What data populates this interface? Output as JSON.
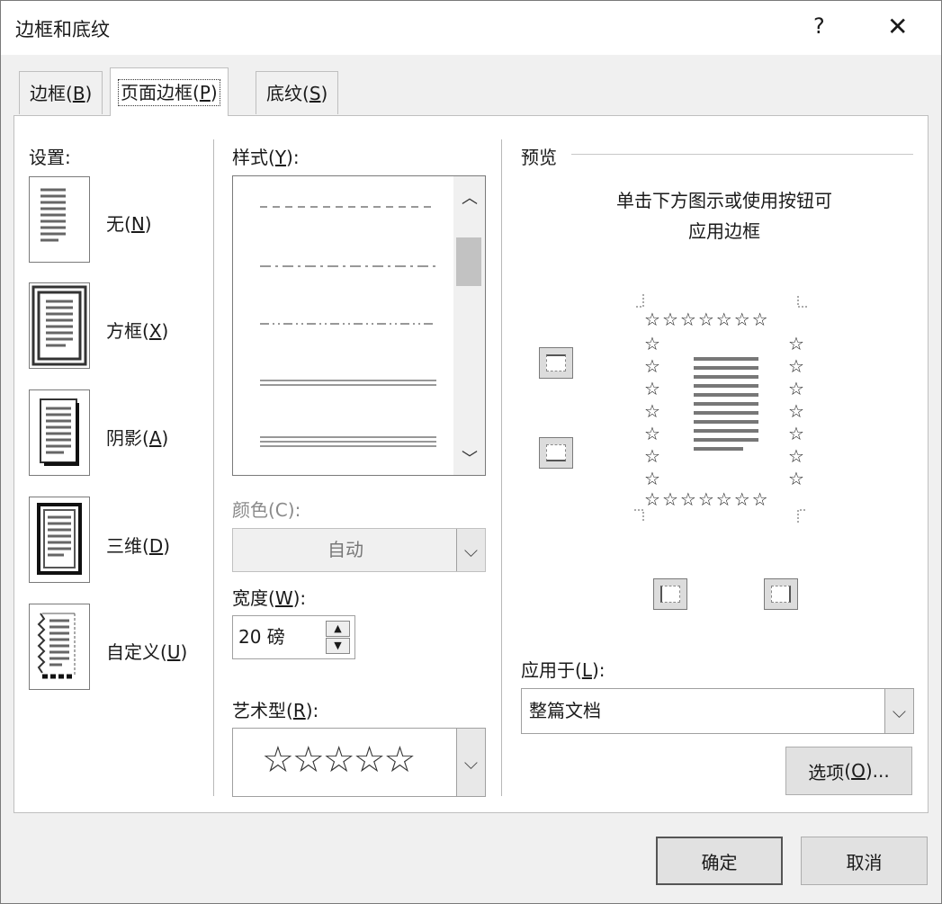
{
  "window": {
    "title": "边框和底纹",
    "help": "?",
    "close": "✕"
  },
  "tabs": [
    {
      "label": "边框",
      "key": "B"
    },
    {
      "label": "页面边框",
      "key": "P"
    },
    {
      "label": "底纹",
      "key": "S"
    }
  ],
  "settings": {
    "heading": "设置:",
    "items": [
      {
        "label": "无",
        "key": "N"
      },
      {
        "label": "方框",
        "key": "X"
      },
      {
        "label": "阴影",
        "key": "A"
      },
      {
        "label": "三维",
        "key": "D"
      },
      {
        "label": "自定义",
        "key": "U"
      }
    ]
  },
  "style": {
    "heading": "样式",
    "key": "Y",
    "suffix": ":"
  },
  "color": {
    "label": "颜色(C):",
    "value": "自动"
  },
  "width": {
    "heading": "宽度",
    "key": "W",
    "suffix": ":",
    "value": "20 磅"
  },
  "art": {
    "heading": "艺术型",
    "key": "R",
    "suffix": ":",
    "value": "☆☆☆☆☆"
  },
  "preview": {
    "heading": "预览",
    "hint_line1": "单击下方图示或使用按钮可",
    "hint_line2": "应用边框",
    "star": "☆"
  },
  "apply_to": {
    "heading": "应用于",
    "key": "L",
    "suffix": ":",
    "value": "整篇文档"
  },
  "buttons": {
    "options_label": "选项",
    "options_key": "O",
    "options_suffix": "...",
    "ok": "确定",
    "cancel": "取消"
  }
}
